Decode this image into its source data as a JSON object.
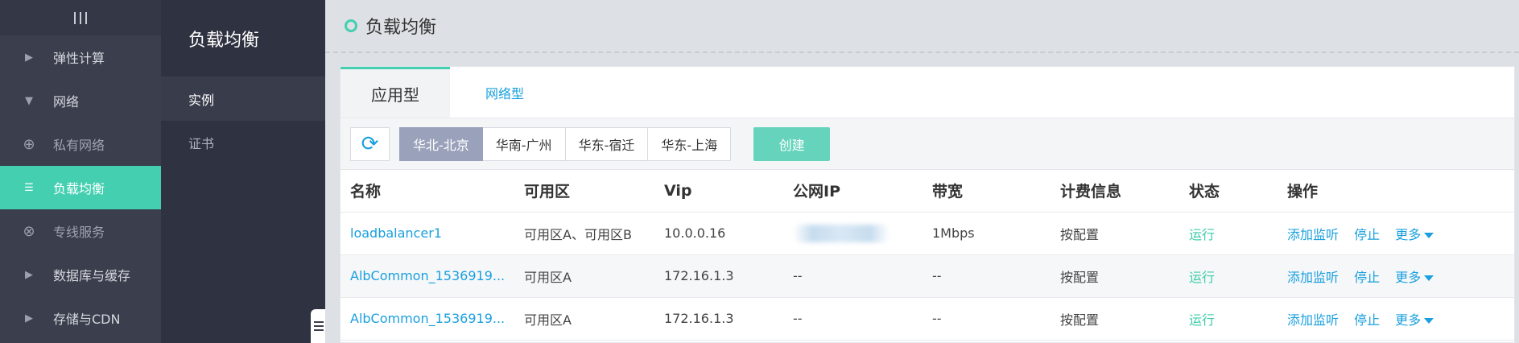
{
  "nav": {
    "items": [
      {
        "label": "弹性计算",
        "icon": "caret-right-icon"
      },
      {
        "label": "网络",
        "icon": "caret-down-icon"
      },
      {
        "label": "私有网络",
        "icon": "globe-icon"
      },
      {
        "label": "负载均衡",
        "icon": "sliders-icon"
      },
      {
        "label": "专线服务",
        "icon": "connection-icon"
      },
      {
        "label": "数据库与缓存",
        "icon": "caret-right-icon"
      },
      {
        "label": "存储与CDN",
        "icon": "caret-right-icon"
      }
    ]
  },
  "subnav": {
    "title": "负载均衡",
    "items": [
      {
        "label": "实例"
      },
      {
        "label": "证书"
      }
    ]
  },
  "header": {
    "title": "负载均衡"
  },
  "tabs": [
    {
      "label": "应用型"
    },
    {
      "label": "网络型"
    }
  ],
  "toolbar": {
    "regions": [
      "华北-北京",
      "华南-广州",
      "华东-宿迁",
      "华东-上海"
    ],
    "create_label": "创建"
  },
  "table": {
    "columns": [
      "名称",
      "可用区",
      "Vip",
      "公网IP",
      "带宽",
      "计费信息",
      "状态",
      "操作"
    ],
    "rows": [
      {
        "name": "loadbalancer1",
        "zone": "可用区A、可用区B",
        "vip": "10.0.0.16",
        "public_ip": "",
        "bandwidth": "1Mbps",
        "billing": "按配置",
        "status": "运行"
      },
      {
        "name": "AlbCommon_1536919...",
        "zone": "可用区A",
        "vip": "172.16.1.3",
        "public_ip": "--",
        "bandwidth": "--",
        "billing": "按配置",
        "status": "运行"
      },
      {
        "name": "AlbCommon_1536919...",
        "zone": "可用区A",
        "vip": "172.16.1.3",
        "public_ip": "--",
        "bandwidth": "--",
        "billing": "按配置",
        "status": "运行"
      }
    ],
    "actions": {
      "add_listener": "添加监听",
      "stop": "停止",
      "more": "更多"
    }
  },
  "colors": {
    "accent": "#44cfb1",
    "link": "#1aa0de",
    "region_active": "#9aa2bb",
    "nav_bg": "#3a3e4d"
  }
}
